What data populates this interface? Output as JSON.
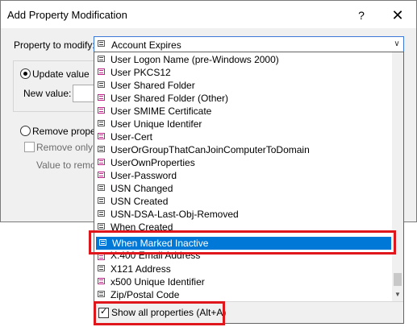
{
  "dialog": {
    "title": "Add Property Modification",
    "help_glyph": "?",
    "close_glyph": "✕",
    "property_label": "Property to modify:",
    "update_value_label": "Update value",
    "new_value_label": "New value:",
    "remove_property_label": "Remove propert",
    "remove_only_label": "Remove only s",
    "value_to_remove_label": "Value to remo"
  },
  "combo": {
    "selected": "Account Expires"
  },
  "dropdown": {
    "items": [
      {
        "label": "User Logon Name (pre-Windows 2000)",
        "icon": "gray-attribute-icon"
      },
      {
        "label": "User PKCS12",
        "icon": "pink-attribute-icon"
      },
      {
        "label": "User Shared Folder",
        "icon": "gray-attribute-icon"
      },
      {
        "label": "User Shared Folder (Other)",
        "icon": "pink-attribute-icon"
      },
      {
        "label": "User SMIME Certificate",
        "icon": "pink-attribute-icon"
      },
      {
        "label": "User Unique Identifer",
        "icon": "gray-attribute-icon"
      },
      {
        "label": "User-Cert",
        "icon": "pink-attribute-icon"
      },
      {
        "label": "UserOrGroupThatCanJoinComputerToDomain",
        "icon": "gray-attribute-icon"
      },
      {
        "label": "UserOwnProperties",
        "icon": "pink-attribute-icon"
      },
      {
        "label": "User-Password",
        "icon": "pink-attribute-icon"
      },
      {
        "label": "USN Changed",
        "icon": "gray-attribute-icon"
      },
      {
        "label": "USN Created",
        "icon": "gray-attribute-icon"
      },
      {
        "label": "USN-DSA-Last-Obj-Removed",
        "icon": "gray-attribute-icon"
      },
      {
        "label": "When Created",
        "icon": "gray-attribute-icon"
      },
      {
        "label": "When Marked Inactive",
        "icon": "gray-attribute-icon",
        "selected": true
      },
      {
        "label": "X.400 Email Address",
        "icon": "pink-attribute-icon"
      },
      {
        "label": "X121 Address",
        "icon": "gray-attribute-icon"
      },
      {
        "label": "x500 Unique Identifier",
        "icon": "pink-attribute-icon"
      },
      {
        "label": "Zip/Postal Code",
        "icon": "gray-attribute-icon"
      }
    ],
    "show_all_label": "Show all properties (Alt+A)",
    "show_all_checked": true,
    "scroll_down_glyph": "▼",
    "combo_arrow_glyph": "∨",
    "checkmark_glyph": "✓"
  },
  "colors": {
    "selection": "#0078d7",
    "highlight_border": "#e0161d"
  }
}
